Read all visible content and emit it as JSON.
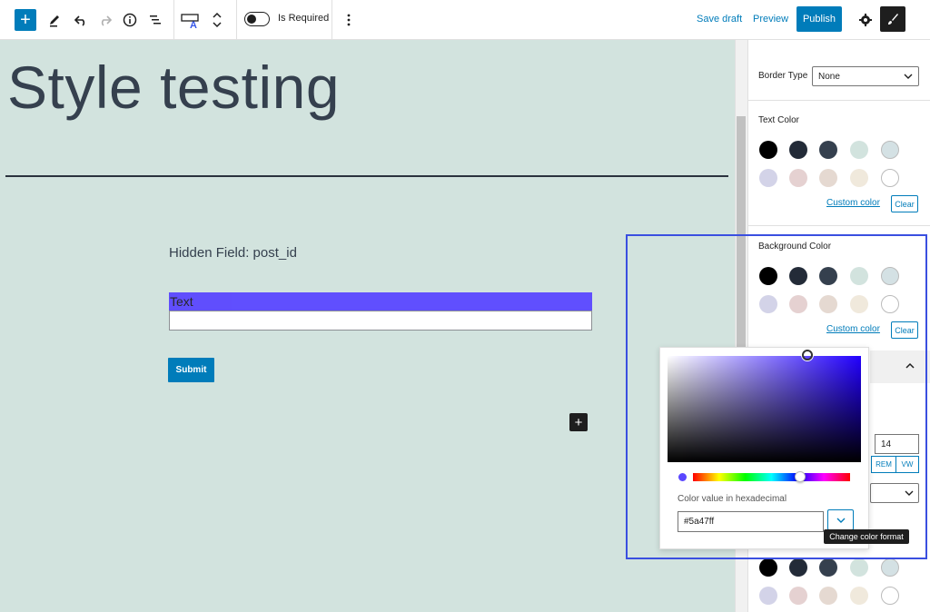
{
  "toolbar": {
    "add_icon": "plus-icon",
    "is_required_label": "Is Required",
    "save_draft": "Save draft",
    "preview": "Preview",
    "publish": "Publish"
  },
  "canvas": {
    "title": "Style testing",
    "hidden_field": "Hidden Field: post_id",
    "text_label": "Text",
    "submit": "Submit",
    "text_label_bg": "#5a47ff",
    "background": "#d2e3de"
  },
  "sidebar": {
    "border_type_label": "Border Type",
    "border_type_value": "None",
    "text_color": {
      "heading": "Text Color",
      "swatches": [
        "#000000",
        "#232b38",
        "#35404e",
        "#d2e3de",
        "#d4e1e4",
        "#d3d3e8",
        "#e5d1d1",
        "#e5d9d1",
        "#f0e9dc",
        "#ffffff"
      ],
      "custom_link": "Custom color",
      "clear": "Clear"
    },
    "background_color": {
      "heading": "Background Color",
      "swatches": [
        "#000000",
        "#232b38",
        "#35404e",
        "#d2e3de",
        "#d4e1e4",
        "#d3d3e8",
        "#e5d1d1",
        "#e5d9d1",
        "#f0e9dc",
        "#ffffff"
      ],
      "custom_link": "Custom color",
      "clear": "Clear"
    },
    "font_size_value": "14",
    "unit_rem": "REM",
    "unit_vw": "VW",
    "bottom_swatches": [
      "#000000",
      "#232b38",
      "#35404e",
      "#d2e3de",
      "#d4e1e4",
      "#d3d3e8",
      "#e5d1d1",
      "#e5d9d1",
      "#f0e9dc",
      "#ffffff"
    ]
  },
  "picker": {
    "hex_label": "Color value in hexadecimal",
    "hex_value": "#5a47ff",
    "tooltip": "Change color format",
    "current_color": "#5a47ff"
  }
}
